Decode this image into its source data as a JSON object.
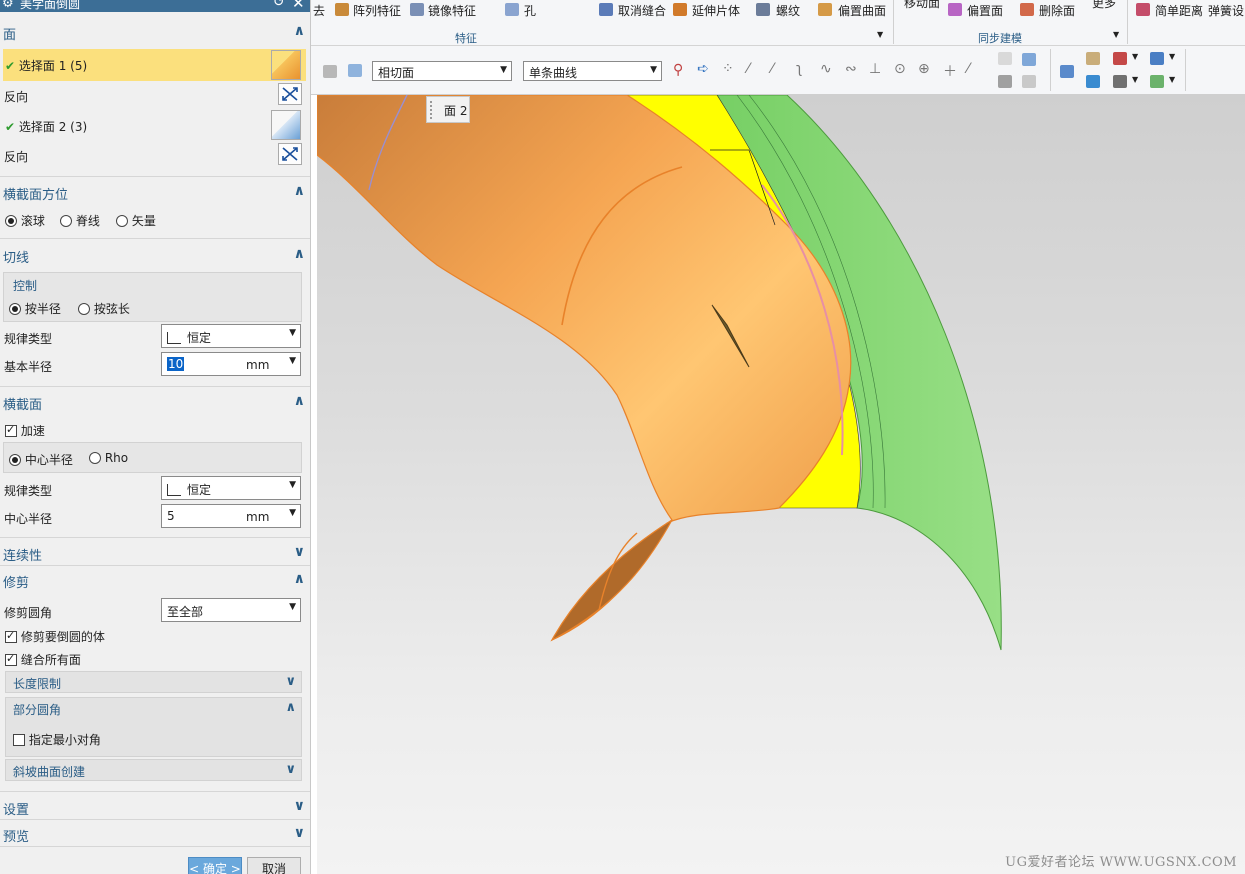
{
  "dialog": {
    "title": "美学面倒圆",
    "sections": {
      "face": {
        "header": "面",
        "select1": "选择面 1 (5)",
        "reverse1": "反向",
        "select2": "选择面 2 (3)",
        "reverse2": "反向"
      },
      "orientation": {
        "header": "横截面方位",
        "options": [
          "滚球",
          "脊线",
          "矢量"
        ],
        "selected": "滚球"
      },
      "tangent": {
        "header": "切线",
        "control_header": "控制",
        "options": [
          "按半径",
          "按弦长"
        ],
        "selected": "按半径",
        "law_label": "规律类型",
        "law_value": "恒定",
        "radius_label": "基本半径",
        "radius_value": "10",
        "radius_unit": "mm"
      },
      "cross_section": {
        "header": "横截面",
        "accelerate_label": "加速",
        "accelerate_checked": true,
        "options": [
          "中心半径",
          "Rho"
        ],
        "selected": "中心半径",
        "law_label": "规律类型",
        "law_value": "恒定",
        "radius_label": "中心半径",
        "radius_value": "5",
        "radius_unit": "mm"
      },
      "continuity": {
        "header": "连续性"
      },
      "trim": {
        "header": "修剪",
        "trim_label": "修剪圆角",
        "trim_value": "至全部",
        "trim_body_label": "修剪要倒圆的体",
        "trim_body_checked": true,
        "stitch_label": "缝合所有面",
        "stitch_checked": true,
        "length_limit": "长度限制",
        "partial": "部分圆角",
        "min_angle_label": "指定最小对角",
        "min_angle_checked": false,
        "ramp": "斜坡曲面创建"
      },
      "settings": {
        "header": "设置"
      },
      "preview": {
        "header": "预览"
      }
    },
    "ok": "< 确定 >",
    "cancel": "取消"
  },
  "ribbon": {
    "items": [
      "去",
      "阵列特征",
      "镜像特征",
      "孔",
      "取消缝合",
      "延伸片体",
      "螺纹",
      "偏置曲面",
      "移动面",
      "偏置面",
      "删除面",
      "更多",
      "简单距离",
      "弹簧设"
    ],
    "groups": [
      "特征",
      "同步建模"
    ]
  },
  "selection_bar": {
    "face_rule": "相切面",
    "curve_rule": "单条曲线"
  },
  "viewport": {
    "face_tip": "面 2",
    "watermark": "UG爱好者论坛 WWW.UGSNX.COM"
  },
  "colors": {
    "accent": "#2a5d86",
    "selected_row": "#fbe07d",
    "orange_face": "#f6a755",
    "yellow_face": "#ffff00",
    "green_face": "#86d674"
  }
}
